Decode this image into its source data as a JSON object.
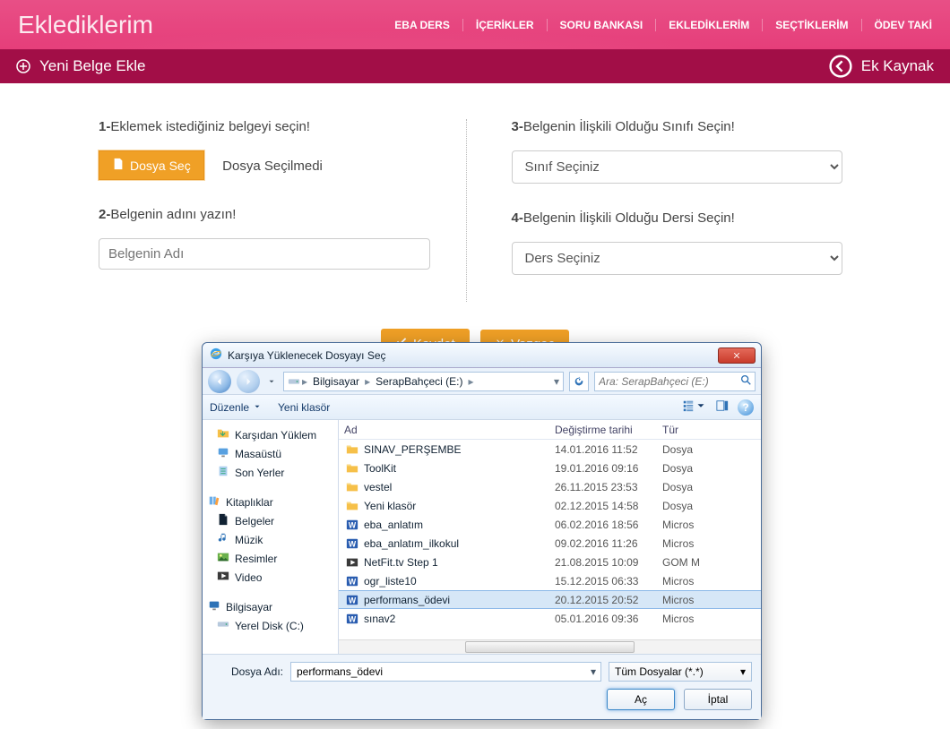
{
  "header": {
    "brand": "Eklediklerim",
    "nav": [
      "EBA DERS",
      "İÇERİKLER",
      "SORU BANKASI",
      "EKLEDİKLERİM",
      "SEÇTİKLERİM",
      "ÖDEV TAKİ"
    ]
  },
  "actionbar": {
    "left": "Yeni Belge Ekle",
    "right": "Ek Kaynak"
  },
  "form": {
    "step1_label": "Eklemek istediğiniz belgeyi seçin!",
    "btn_choose": "Dosya Seç",
    "file_status": "Dosya Seçilmedi",
    "step2_label": "Belgenin adını yazın!",
    "name_placeholder": "Belgenin Adı",
    "step3_label": "Belgenin İlişkili Olduğu Sınıfı Seçin!",
    "select_class": "Sınıf Seçiniz",
    "step4_label": "Belgenin İlişkili Olduğu Dersi Seçin!",
    "select_course": "Ders Seçiniz",
    "btn_save": "Kaydet",
    "btn_cancel": "Vazgeç"
  },
  "dialog": {
    "title": "Karşıya Yüklenecek Dosyayı Seç",
    "breadcrumb": {
      "seg1": "Bilgisayar",
      "seg2": "SerapBahçeci (E:)"
    },
    "search_placeholder": "Ara: SerapBahçeci (E:)",
    "toolbar": {
      "organize": "Düzenle",
      "newfolder": "Yeni klasör"
    },
    "tree": {
      "downloads": "Karşıdan Yüklem",
      "desktop": "Masaüstü",
      "recent": "Son Yerler",
      "libs": "Kitaplıklar",
      "docs": "Belgeler",
      "music": "Müzik",
      "pictures": "Resimler",
      "video": "Video",
      "computer": "Bilgisayar",
      "cdrive": "Yerel Disk (C:)"
    },
    "cols": {
      "name": "Ad",
      "date": "Değiştirme tarihi",
      "type": "Tür"
    },
    "files": [
      {
        "icon": "folder",
        "name": "SINAV_PERŞEMBE",
        "date": "14.01.2016 11:52",
        "type": "Dosya"
      },
      {
        "icon": "folder",
        "name": "ToolKit",
        "date": "19.01.2016 09:16",
        "type": "Dosya"
      },
      {
        "icon": "folder",
        "name": "vestel",
        "date": "26.11.2015 23:53",
        "type": "Dosya"
      },
      {
        "icon": "folder",
        "name": "Yeni klasör",
        "date": "02.12.2015 14:58",
        "type": "Dosya"
      },
      {
        "icon": "word",
        "name": "eba_anlatım",
        "date": "06.02.2016 18:56",
        "type": "Micros"
      },
      {
        "icon": "word",
        "name": "eba_anlatım_ilkokul",
        "date": "09.02.2016 11:26",
        "type": "Micros"
      },
      {
        "icon": "video",
        "name": "NetFit.tv Step 1",
        "date": "21.08.2015 10:09",
        "type": "GOM M"
      },
      {
        "icon": "word",
        "name": "ogr_liste10",
        "date": "15.12.2015 06:33",
        "type": "Micros"
      },
      {
        "icon": "word",
        "name": "performans_ödevi",
        "date": "20.12.2015 20:52",
        "type": "Micros",
        "selected": true
      },
      {
        "icon": "word",
        "name": "sınav2",
        "date": "05.01.2016 09:36",
        "type": "Micros"
      }
    ],
    "footer": {
      "filename_label": "Dosya Adı:",
      "filename_value": "performans_ödevi",
      "filter": "Tüm Dosyalar (*.*)",
      "open": "Aç",
      "cancel": "İptal"
    }
  }
}
